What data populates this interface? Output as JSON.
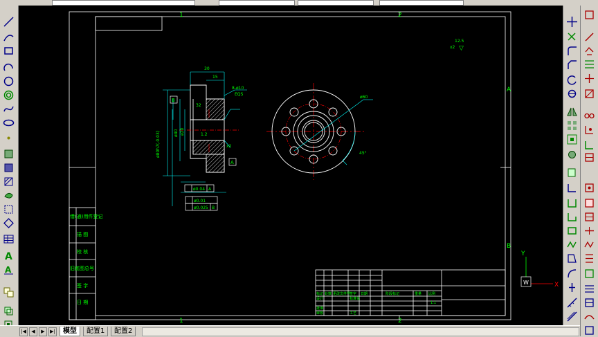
{
  "tabs": [
    {
      "label": "模型",
      "active": true
    },
    {
      "label": "配置1",
      "active": false
    },
    {
      "label": "配置2",
      "active": false
    }
  ],
  "nav_buttons": [
    "|◀",
    "◀",
    "▶",
    "▶|"
  ],
  "zone_labels": {
    "top_1": "1",
    "top_2": "2",
    "bottom_1": "1",
    "bottom_2": "2",
    "right_a": "A",
    "right_b": "B"
  },
  "ucs": {
    "y": "Y",
    "x": "X",
    "w": "W"
  },
  "drawing": {
    "dim_30": "30",
    "dim_15": "15",
    "chamfer_note": "8-ø10",
    "chamfer_sub": "EQS",
    "datum_b": "B",
    "datum_a": "A",
    "dim_d80": "ø80h7(-0.03)",
    "dim_d40": "ø40",
    "dim_d20": "ø20",
    "dim_32": "32",
    "dim_x2": "x2",
    "dim_12": "1.2",
    "dim_60": "ø60",
    "angle_45": "45°",
    "roughness": "12.5",
    "roughness_sym": "▽",
    "tol_perp": "ø0.04",
    "tol_perp_ref": "A",
    "tol_circ": "ø0.01",
    "tol_runout": "ø0.025",
    "tol_runout_ref": "B"
  },
  "left_column": [
    "借(通)用件登记",
    "描 图",
    "校 核",
    "旧底图总号",
    "签 字",
    "日 期"
  ],
  "title_block": {
    "row_a": [
      "标记",
      "处数",
      "更改文件号",
      "签字",
      "日期"
    ],
    "row_b": [
      "设计",
      "标准化"
    ],
    "row_c": [
      "审核",
      "工艺",
      "批准"
    ],
    "stage": [
      "阶段标记",
      "重量",
      "比例"
    ],
    "scale": "1:1"
  }
}
